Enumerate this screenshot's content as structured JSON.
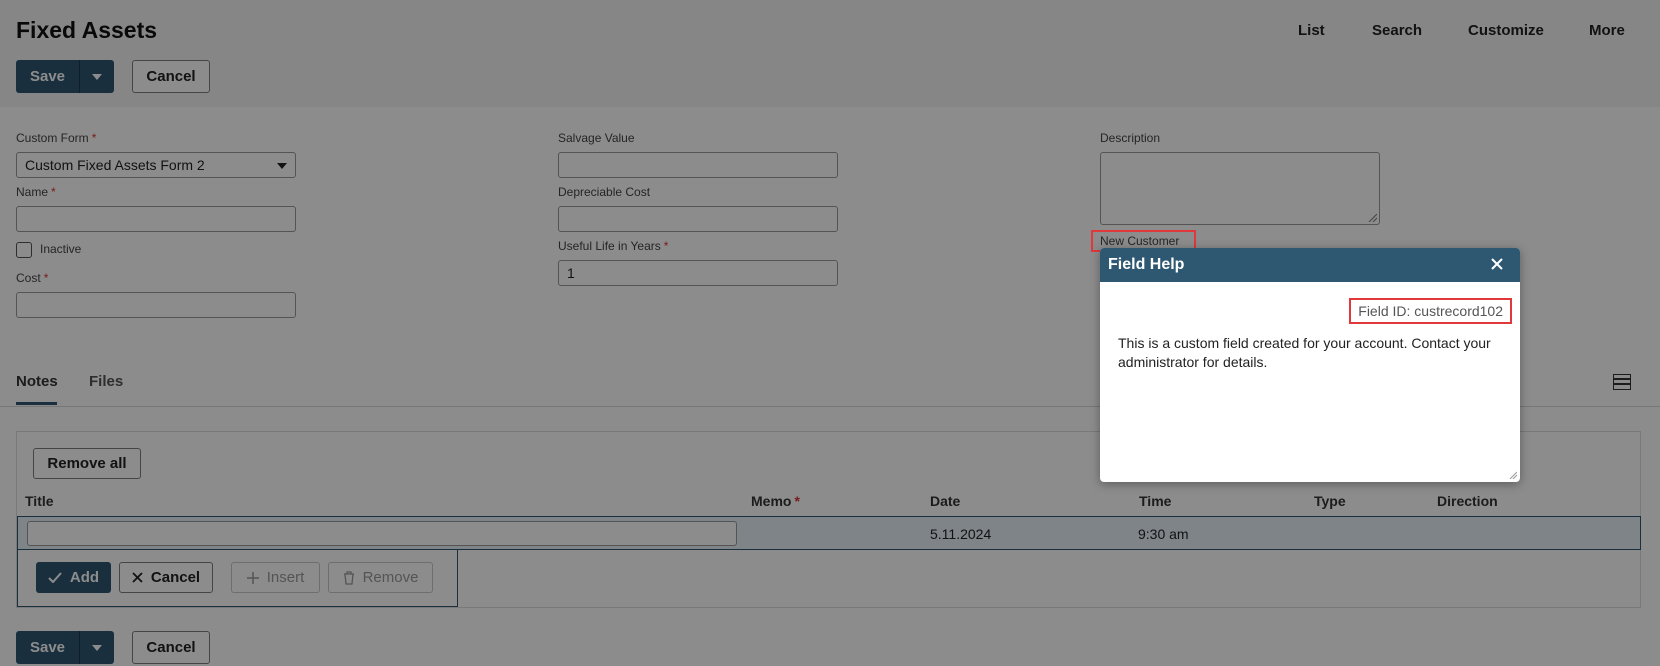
{
  "header": {
    "title": "Fixed Assets",
    "nav": [
      "List",
      "Search",
      "Customize",
      "More"
    ]
  },
  "toolbar": {
    "save_label": "Save",
    "cancel_label": "Cancel"
  },
  "form": {
    "custom_form": {
      "label": "Custom Form",
      "required": "*",
      "value": "Custom Fixed Assets Form 2"
    },
    "name": {
      "label": "Name",
      "required": "*",
      "value": ""
    },
    "inactive": {
      "label": "Inactive"
    },
    "cost": {
      "label": "Cost",
      "required": "*",
      "value": ""
    },
    "salvage_value": {
      "label": "Salvage Value",
      "value": ""
    },
    "depreciable_cost": {
      "label": "Depreciable Cost",
      "value": ""
    },
    "useful_life": {
      "label": "Useful Life in Years",
      "required": "*",
      "value": "1"
    },
    "description": {
      "label": "Description"
    },
    "new_customer": {
      "label": "New Customer"
    }
  },
  "tabs": [
    "Notes",
    "Files"
  ],
  "sublist": {
    "remove_all_label": "Remove all",
    "columns": [
      "Title",
      "Memo",
      "Date",
      "Time",
      "Type",
      "Direction"
    ],
    "memo_required": "*",
    "row": {
      "title": "",
      "memo": "",
      "date": "5.11.2024",
      "time": "9:30 am",
      "type": "",
      "direction": ""
    },
    "actions": {
      "add": "Add",
      "cancel": "Cancel",
      "insert": "Insert",
      "remove": "Remove"
    }
  },
  "field_help": {
    "title": "Field Help",
    "field_id": "Field ID: custrecord102",
    "body": "This is a custom field created for your account. Contact your administrator for details."
  },
  "colors": {
    "accent": "#2e5772",
    "highlight": "#e0383b",
    "overlay": "rgba(0,0,0,0.45)"
  }
}
